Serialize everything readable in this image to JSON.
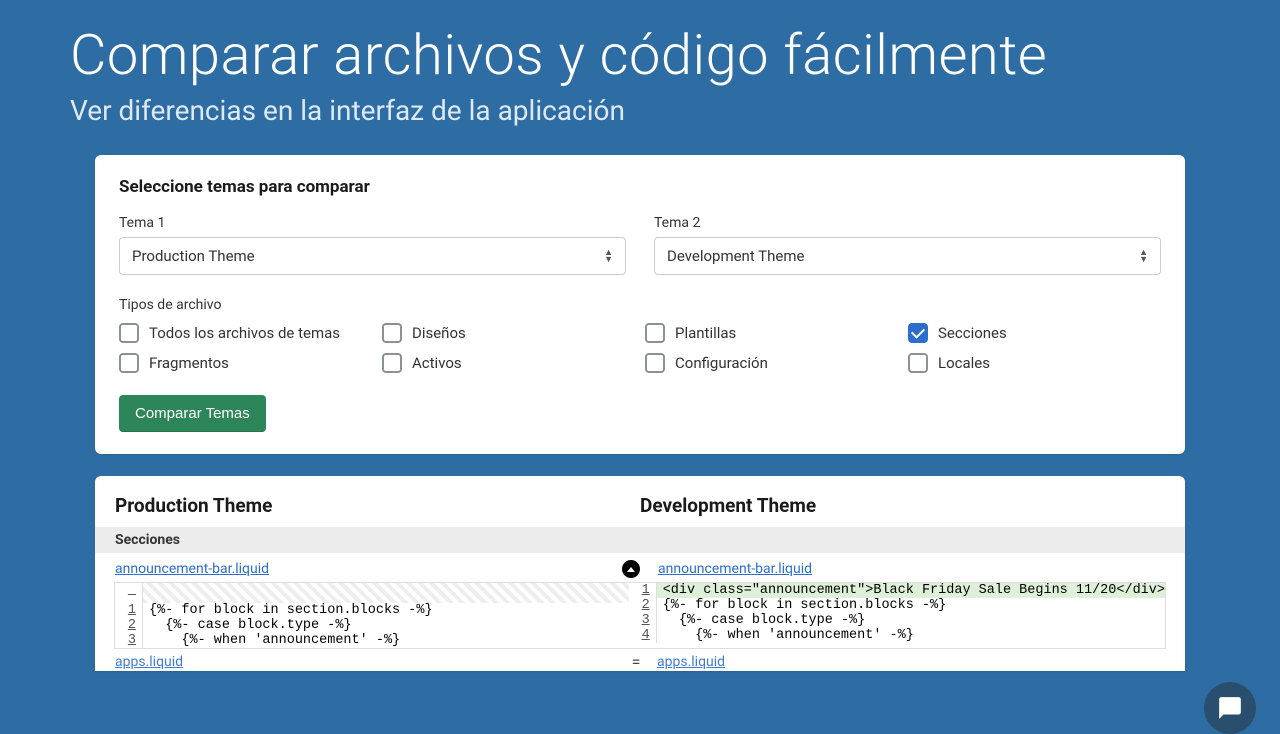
{
  "hero": {
    "title": "Comparar archivos y código fácilmente",
    "subtitle": "Ver diferencias en la interfaz de la aplicación"
  },
  "form": {
    "title": "Seleccione temas para comparar",
    "theme1_label": "Tema 1",
    "theme1_value": "Production Theme",
    "theme2_label": "Tema 2",
    "theme2_value": "Development Theme",
    "filetypes_label": "Tipos de archivo",
    "checkboxes": {
      "all": "Todos los archivos de temas",
      "disenos": "Diseños",
      "plantillas": "Plantillas",
      "secciones": "Secciones",
      "fragmentos": "Fragmentos",
      "activos": "Activos",
      "configuracion": "Configuración",
      "locales": "Locales"
    },
    "submit": "Comparar Temas"
  },
  "results": {
    "left_title": "Production Theme",
    "right_title": "Development Theme",
    "section": "Secciones",
    "file1": "announcement-bar.liquid",
    "file2": "apps.liquid",
    "eq": "=",
    "left_lines": {
      "l1": "{%- for block in section.blocks -%}",
      "l2": "  {%- case block.type -%}",
      "l3": "    {%- when 'announcement' -%}"
    },
    "right_lines": {
      "l1": "<div class=\"announcement\">Black Friday Sale Begins 11/20</div>",
      "l2": "{%- for block in section.blocks -%}",
      "l3": "  {%- case block.type -%}",
      "l4": "    {%- when 'announcement' -%}"
    },
    "ln": {
      "n1": "1",
      "n2": "2",
      "n3": "3",
      "n4": "4"
    }
  }
}
